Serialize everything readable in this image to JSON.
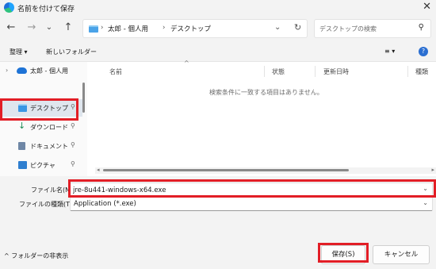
{
  "window": {
    "title": "名前を付けて保存",
    "close_glyph": "✕",
    "app_icon": "edge-icon"
  },
  "nav": {
    "back": "←",
    "forward": "→",
    "recent": "⌄",
    "up": "↑"
  },
  "address": {
    "segments": [
      "太郎 - 個人用",
      "デスクトップ"
    ],
    "separator": "›",
    "dropdown": "⌄",
    "refresh": "↻"
  },
  "search": {
    "placeholder": "デスクトップの検索",
    "icon": "⚲"
  },
  "toolbar": {
    "organize": "整理 ▾",
    "new_folder": "新しいフォルダー",
    "view_icon": "≡ ▾",
    "help_icon": "?"
  },
  "sidebar": {
    "cloud_item": {
      "label": "太郎 - 個人用",
      "icon": "cloud-icon"
    },
    "items": [
      {
        "label": "デスクトップ",
        "icon": "desktop-folder-icon",
        "pin": "📌"
      },
      {
        "label": "ダウンロード",
        "icon": "download-icon",
        "pin": "📌"
      },
      {
        "label": "ドキュメント",
        "icon": "document-icon",
        "pin": "📌"
      },
      {
        "label": "ピクチャ",
        "icon": "picture-icon",
        "pin": "📌"
      }
    ]
  },
  "list": {
    "columns": [
      "名前",
      "状態",
      "更新日時",
      "種類"
    ],
    "sort_indicator": "^",
    "empty_message": "検索条件に一致する項目はありません。"
  },
  "form": {
    "filename_label": "ファイル名(N):",
    "filename_value": "jre-8u441-windows-x64.exe",
    "filetype_label": "ファイルの種類(T):",
    "filetype_value": "Application (*.exe)"
  },
  "footer": {
    "hide_folders": "フォルダーの非表示",
    "save": "保存(S)",
    "cancel": "キャンセル"
  },
  "colors": {
    "highlight_red": "#e21e26",
    "chrome_bg": "#f3f3f3"
  }
}
